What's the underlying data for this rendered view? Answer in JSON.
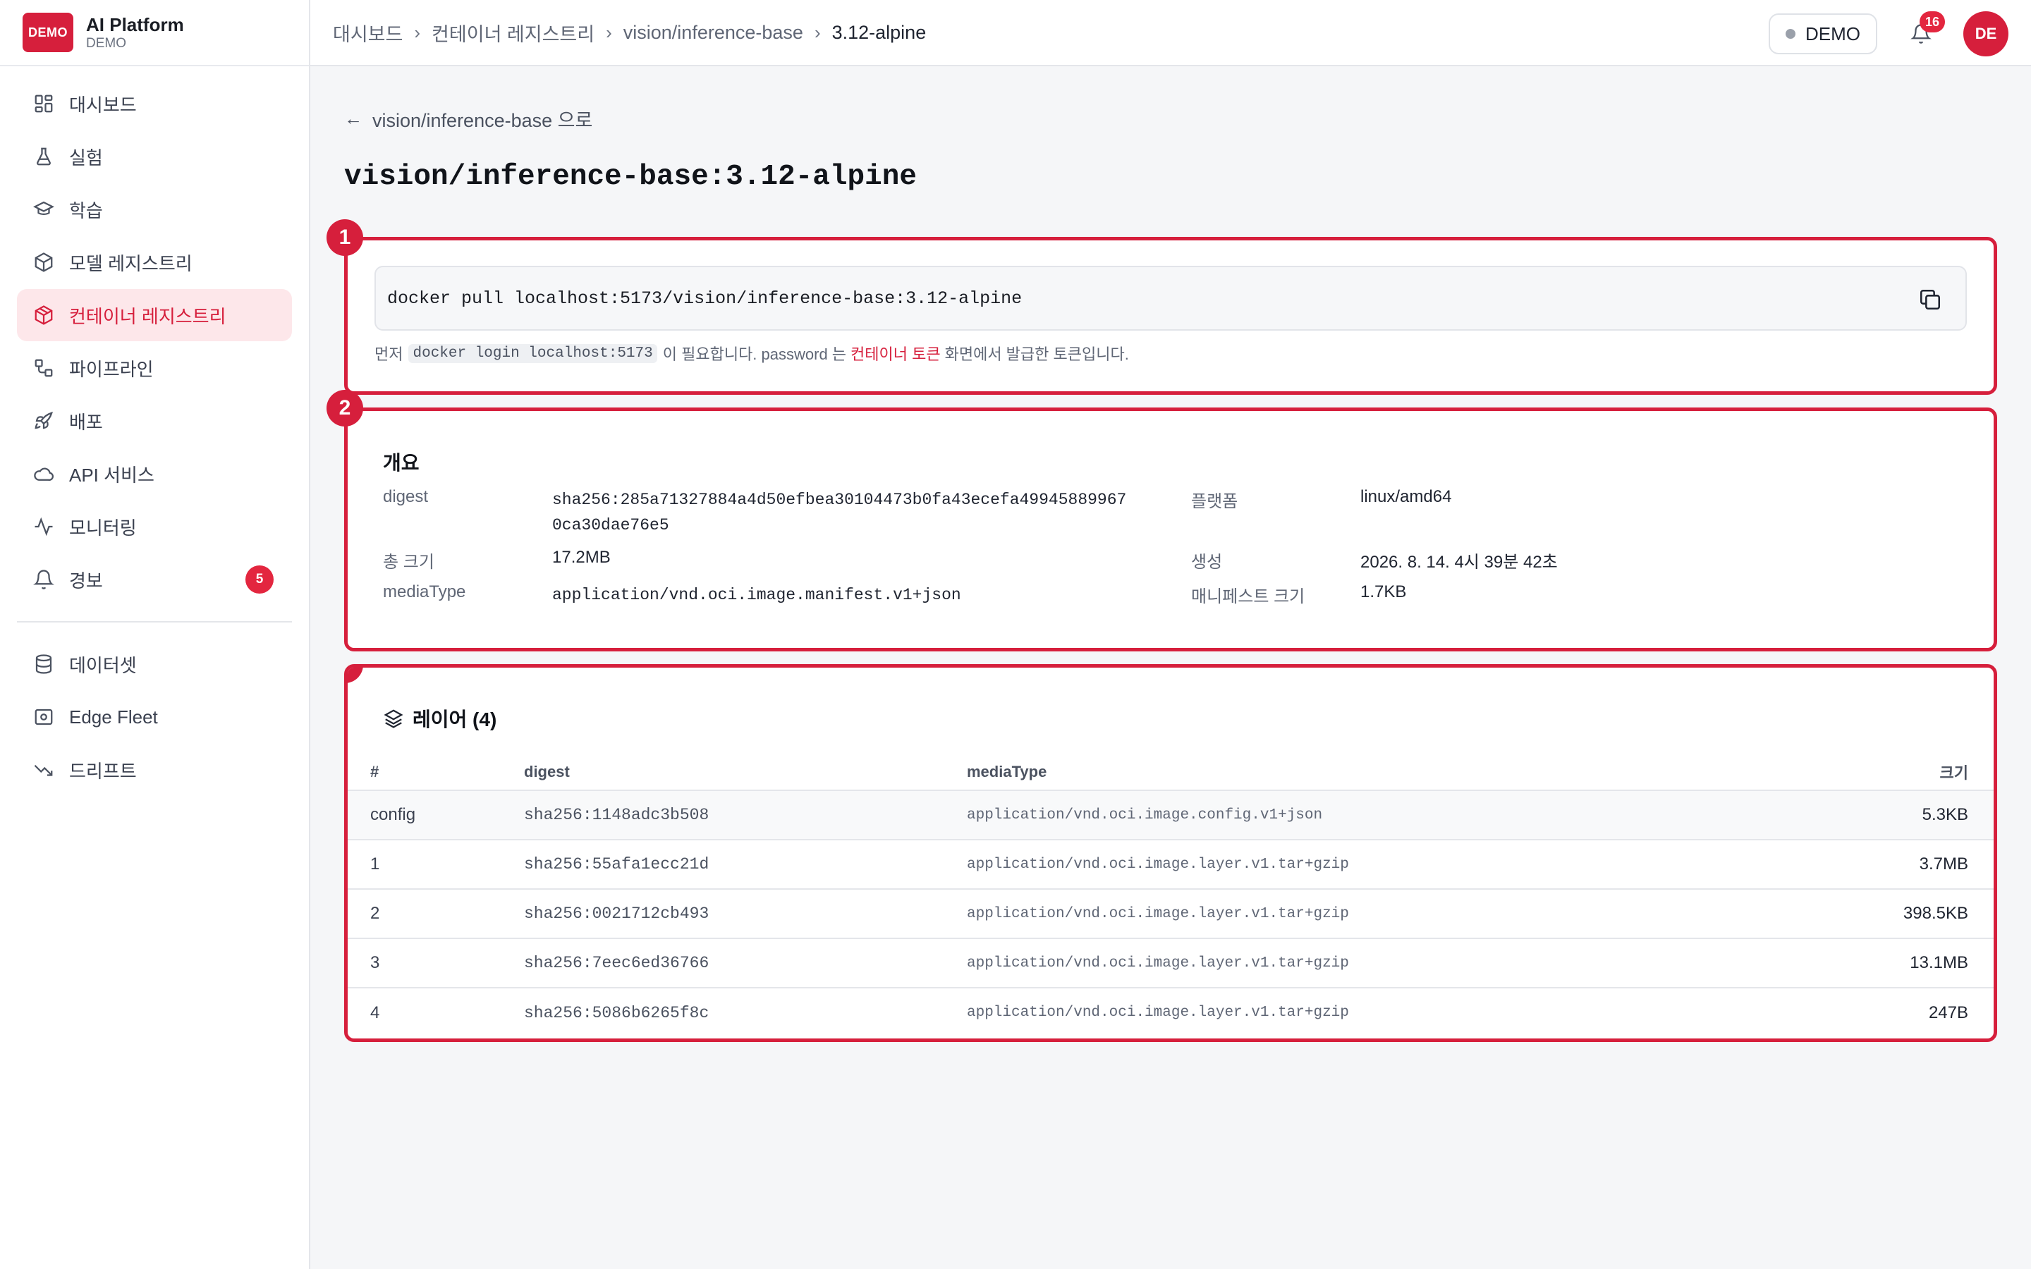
{
  "brand": {
    "badge": "DEMO",
    "title": "AI Platform",
    "subtitle": "DEMO"
  },
  "sidebar": {
    "items": [
      {
        "label": "대시보드",
        "icon": "dashboard-icon"
      },
      {
        "label": "실험",
        "icon": "flask-icon"
      },
      {
        "label": "학습",
        "icon": "graduation-cap-icon"
      },
      {
        "label": "모델 레지스트리",
        "icon": "cube-icon"
      },
      {
        "label": "컨테이너 레지스트리",
        "icon": "container-icon",
        "active": true
      },
      {
        "label": "파이프라인",
        "icon": "workflow-icon"
      },
      {
        "label": "배포",
        "icon": "rocket-icon"
      },
      {
        "label": "API 서비스",
        "icon": "cloud-icon"
      },
      {
        "label": "모니터링",
        "icon": "activity-icon"
      },
      {
        "label": "경보",
        "icon": "bell-icon",
        "badge": "5"
      }
    ],
    "items2": [
      {
        "label": "데이터셋",
        "icon": "database-icon"
      },
      {
        "label": "Edge Fleet",
        "icon": "edge-device-icon"
      },
      {
        "label": "드리프트",
        "icon": "trend-down-icon"
      }
    ]
  },
  "header": {
    "breadcrumbs": [
      "대시보드",
      "컨테이너 레지스트리",
      "vision/inference-base",
      "3.12-alpine"
    ],
    "env_label": "DEMO",
    "notifications": "16",
    "avatar": "DE"
  },
  "page": {
    "back_label": "vision/inference-base 으로",
    "title": "vision/inference-base:3.12-alpine"
  },
  "markers": [
    "1",
    "2",
    "3"
  ],
  "pull": {
    "command": "docker pull localhost:5173/vision/inference-base:3.12-alpine",
    "hint_prefix": "먼저",
    "hint_code": "docker login localhost:5173",
    "hint_mid": "이 필요합니다. password 는",
    "hint_link": "컨테이너 토큰",
    "hint_suffix": "화면에서 발급한 토큰입니다."
  },
  "overview": {
    "title": "개요",
    "digest_label": "digest",
    "digest_line1": "sha256:285a71327884a4d50efbea30104473b0fa43ecefa49945889967",
    "digest_line2": "0ca30dae76e5",
    "platform_label": "플랫폼",
    "platform": "linux/amd64",
    "size_label": "총 크기",
    "size": "17.2MB",
    "created_label": "생성",
    "created": "2026. 8. 14. 4시 39분 42초",
    "media_label": "mediaType",
    "media": "application/vnd.oci.image.manifest.v1+json",
    "manifest_size_label": "매니페스트 크기",
    "manifest_size": "1.7KB"
  },
  "layers": {
    "title": "레이어 (4)",
    "columns": [
      "#",
      "digest",
      "mediaType",
      "크기"
    ],
    "rows": [
      {
        "idx": "config",
        "digest": "sha256:1148adc3b508",
        "media": "application/vnd.oci.image.config.v1+json",
        "size": "5.3KB"
      },
      {
        "idx": "1",
        "digest": "sha256:55afa1ecc21d",
        "media": "application/vnd.oci.image.layer.v1.tar+gzip",
        "size": "3.7MB"
      },
      {
        "idx": "2",
        "digest": "sha256:0021712cb493",
        "media": "application/vnd.oci.image.layer.v1.tar+gzip",
        "size": "398.5KB"
      },
      {
        "idx": "3",
        "digest": "sha256:7eec6ed36766",
        "media": "application/vnd.oci.image.layer.v1.tar+gzip",
        "size": "13.1MB"
      },
      {
        "idx": "4",
        "digest": "sha256:5086b6265f8c",
        "media": "application/vnd.oci.image.layer.v1.tar+gzip",
        "size": "247B"
      }
    ]
  },
  "colors": {
    "accent": "#d61f3c",
    "active_bg": "#fde7ea",
    "badge": "#e3263f"
  }
}
